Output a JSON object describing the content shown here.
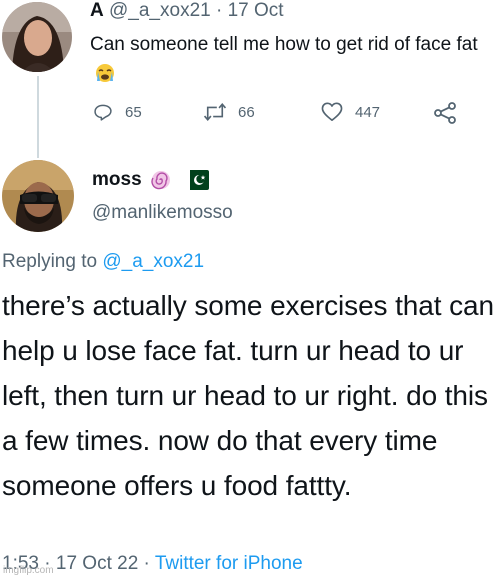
{
  "quoted_tweet": {
    "author_name": "A",
    "handle": "@_a_xox21",
    "separator": " · ",
    "date": "17 Oct",
    "text": "Can someone tell me how to get rid of face fat",
    "emoji_icon": "crying-face-emoji-icon",
    "actions": {
      "replies": "65",
      "retweets": "66",
      "likes": "447"
    }
  },
  "reply_tweet": {
    "author_name": "moss",
    "name_icons": [
      "spiral-icon",
      "pakistan-flag-icon"
    ],
    "handle": "@manlikemosso",
    "replying_prefix": "Replying to ",
    "replying_handle": "@_a_xox21",
    "text": "there’s actually some exercises that can help u lose face fat. turn ur head to ur left, then turn ur head to ur right. do this a few times. now do that every time someone offers u food fattty.",
    "time": "1:53",
    "separator1": " · ",
    "date": "17 Oct 22",
    "separator2": " · ",
    "source": "Twitter for iPhone"
  },
  "watermark": "imgflip.com",
  "colors": {
    "text": "#0f1419",
    "secondary": "#536471",
    "link": "#1d9bf0",
    "thread_line": "#cfd9de"
  }
}
